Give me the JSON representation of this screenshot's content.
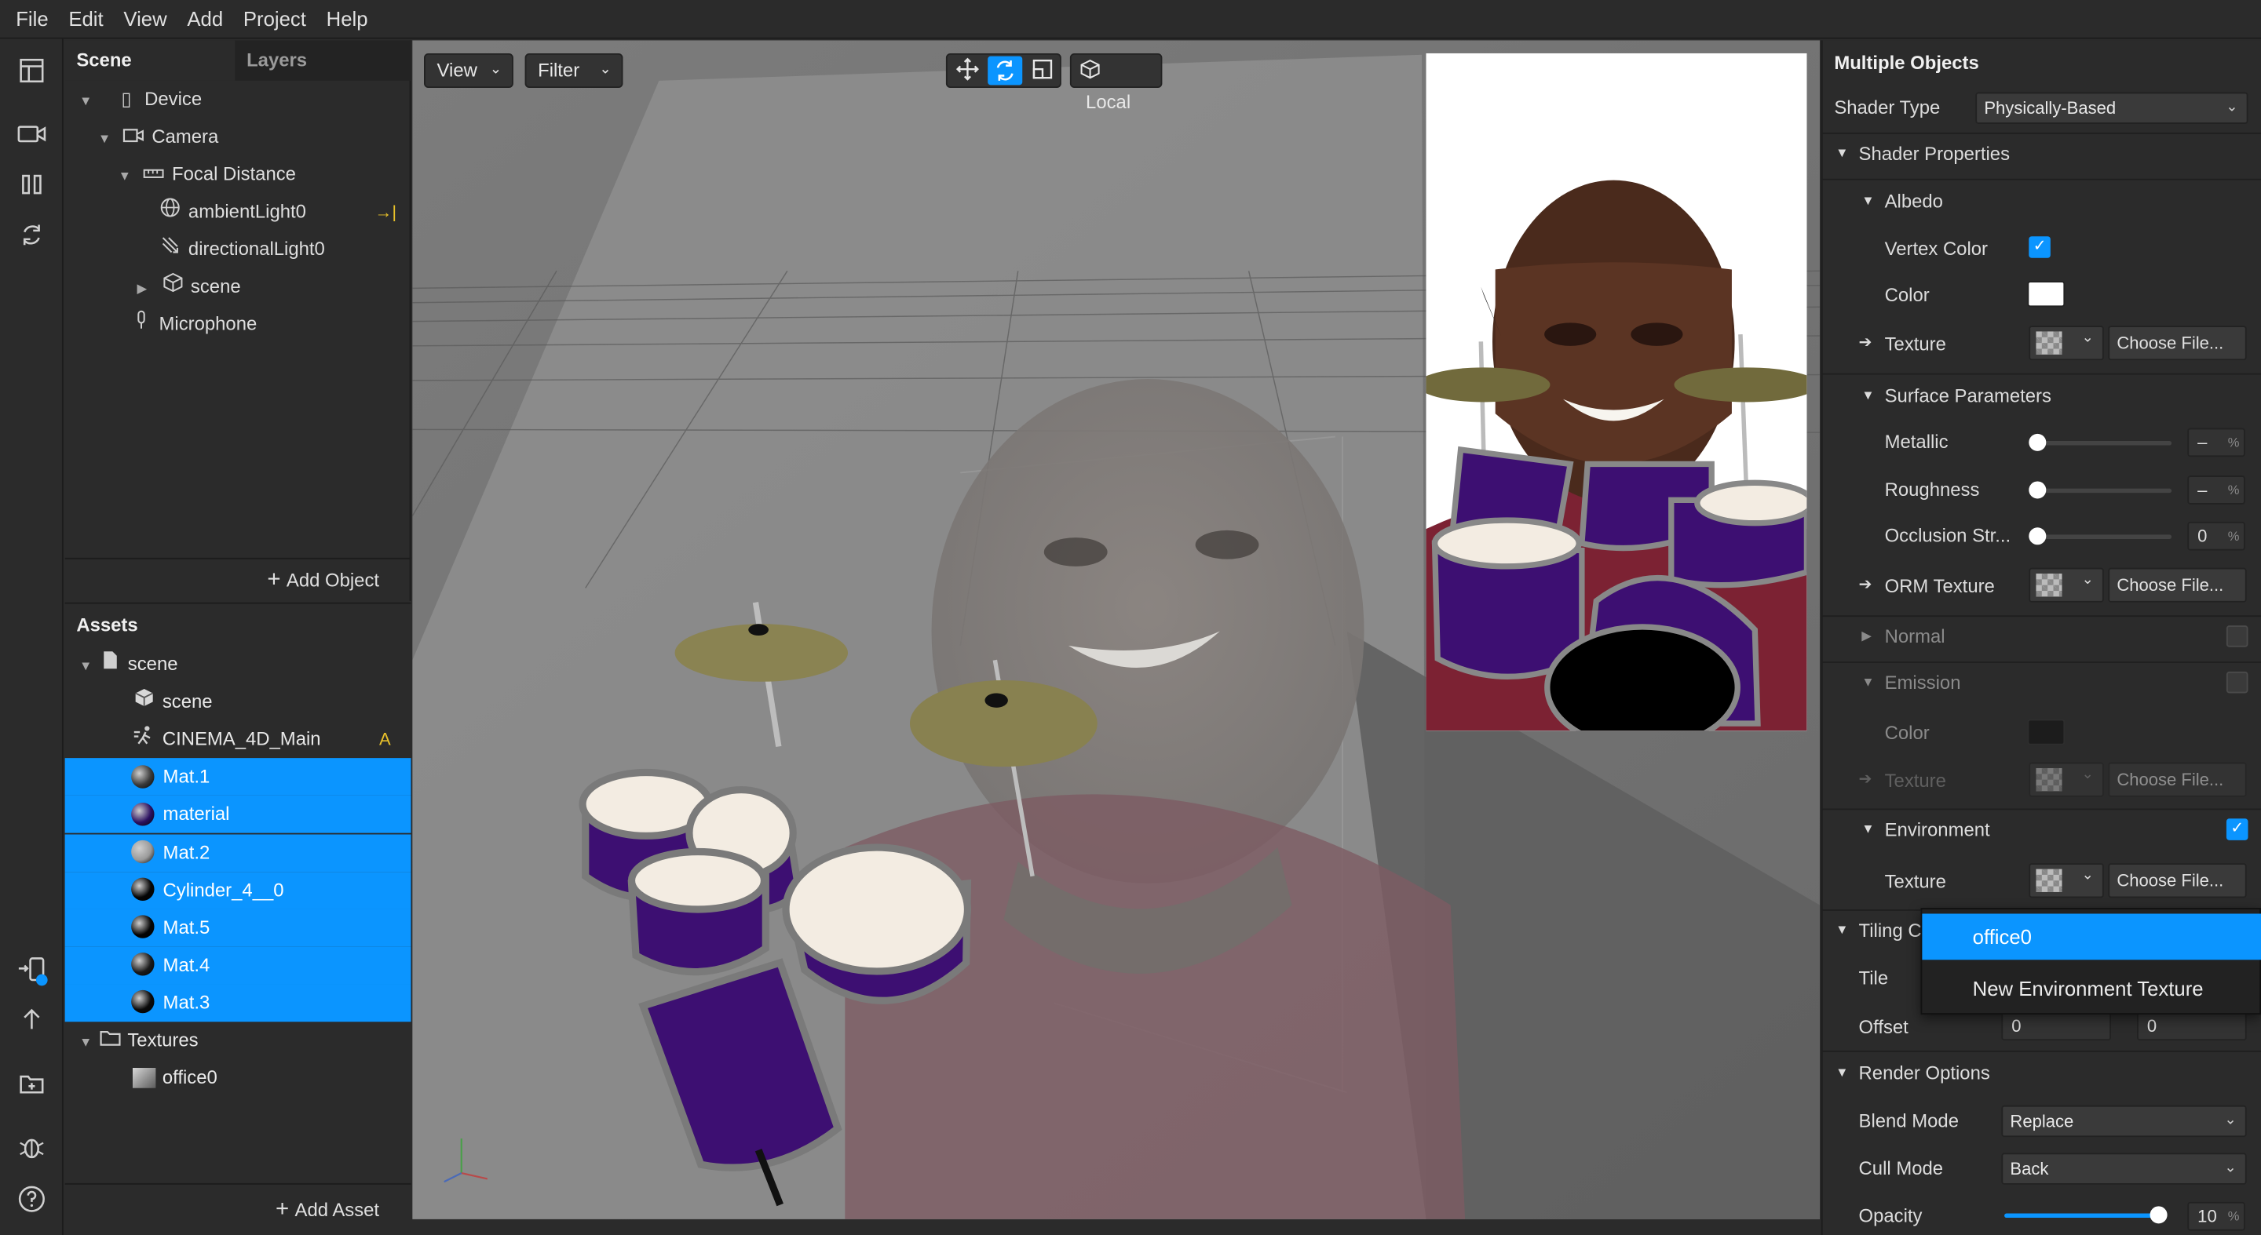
{
  "menu": [
    "File",
    "Edit",
    "View",
    "Add",
    "Project",
    "Help"
  ],
  "scene_panel": {
    "tabs": [
      "Scene",
      "Layers"
    ],
    "tree": [
      {
        "label": "Device",
        "icon": "phone-icon",
        "depth": 0,
        "expanded": true
      },
      {
        "label": "Camera",
        "icon": "camera-icon",
        "depth": 1,
        "expanded": true
      },
      {
        "label": "Focal Distance",
        "icon": "ruler-icon",
        "depth": 2,
        "expanded": true
      },
      {
        "label": "ambientLight0",
        "icon": "globe-light-icon",
        "depth": 3
      },
      {
        "label": "directionalLight0",
        "icon": "directional-light-icon",
        "depth": 3
      },
      {
        "label": "scene",
        "icon": "cube-icon",
        "depth": 3,
        "expanded": false
      },
      {
        "label": "Microphone",
        "icon": "microphone-icon",
        "depth": 1
      }
    ],
    "add_object": "Add Object"
  },
  "assets_panel": {
    "title": "Assets",
    "items": [
      {
        "label": "scene",
        "icon": "file-icon",
        "depth": 0,
        "expanded": true,
        "selected": false
      },
      {
        "label": "scene",
        "icon": "cube-icon",
        "depth": 1,
        "selected": false
      },
      {
        "label": "CINEMA_4D_Main",
        "icon": "animation-icon",
        "depth": 1,
        "badge": "A",
        "selected": false
      },
      {
        "label": "Mat.1",
        "icon": "material-ball-icon",
        "ball": "#3a3a3a",
        "depth": 1,
        "selected": true
      },
      {
        "label": "material",
        "icon": "material-ball-icon",
        "ball": "#2b1060",
        "depth": 1,
        "selected": true
      },
      {
        "label": "Mat.2",
        "icon": "material-ball-icon",
        "ball": "#9a9a9a",
        "depth": 1,
        "selected": true
      },
      {
        "label": "Cylinder_4__0",
        "icon": "material-ball-icon",
        "ball": "#050505",
        "depth": 1,
        "selected": true
      },
      {
        "label": "Mat.5",
        "icon": "material-ball-icon",
        "ball": "#050505",
        "depth": 1,
        "selected": true
      },
      {
        "label": "Mat.4",
        "icon": "material-ball-icon",
        "ball": "#1a1a1a",
        "depth": 1,
        "selected": true
      },
      {
        "label": "Mat.3",
        "icon": "material-ball-icon",
        "ball": "#0a0a0a",
        "depth": 1,
        "selected": true
      },
      {
        "label": "Textures",
        "icon": "folder-icon",
        "depth": 0,
        "expanded": true,
        "selected": false
      },
      {
        "label": "office0",
        "icon": "texture-thumb-icon",
        "depth": 1,
        "selected": false
      }
    ],
    "add_asset": "Add Asset"
  },
  "viewport": {
    "view_label": "View",
    "filter_label": "Filter",
    "space_label": "Local"
  },
  "inspector": {
    "title": "Multiple Objects",
    "shader_type_label": "Shader Type",
    "shader_type_value": "Physically-Based",
    "shader_properties": "Shader Properties",
    "albedo": "Albedo",
    "vertex_color": "Vertex Color",
    "color": "Color",
    "texture": "Texture",
    "choose_file": "Choose File...",
    "surface_parameters": "Surface Parameters",
    "metallic": "Metallic",
    "metallic_value": "–",
    "roughness": "Roughness",
    "roughness_value": "–",
    "occlusion": "Occlusion Str...",
    "occlusion_value": "0",
    "orm_texture": "ORM Texture",
    "normal": "Normal",
    "emission": "Emission",
    "emission_color": "Color",
    "emission_texture": "Texture",
    "environment": "Environment",
    "env_texture": "Texture",
    "tiling": "Tiling C",
    "tile": "Tile",
    "offset": "Offset",
    "offset_x": "0",
    "offset_y": "0",
    "render_options": "Render Options",
    "blend_mode": "Blend Mode",
    "blend_mode_value": "Replace",
    "cull_mode": "Cull Mode",
    "cull_mode_value": "Back",
    "opacity": "Opacity",
    "opacity_value": "10",
    "percent": "%",
    "opacity_level": 0.97
  },
  "env_dropdown": {
    "items": [
      "office0",
      "New Environment Texture"
    ],
    "selected": 0
  },
  "colors": {
    "selection": "#0b95ff",
    "panel": "#2b2b2b",
    "drum_purple": "#3d0f72"
  }
}
